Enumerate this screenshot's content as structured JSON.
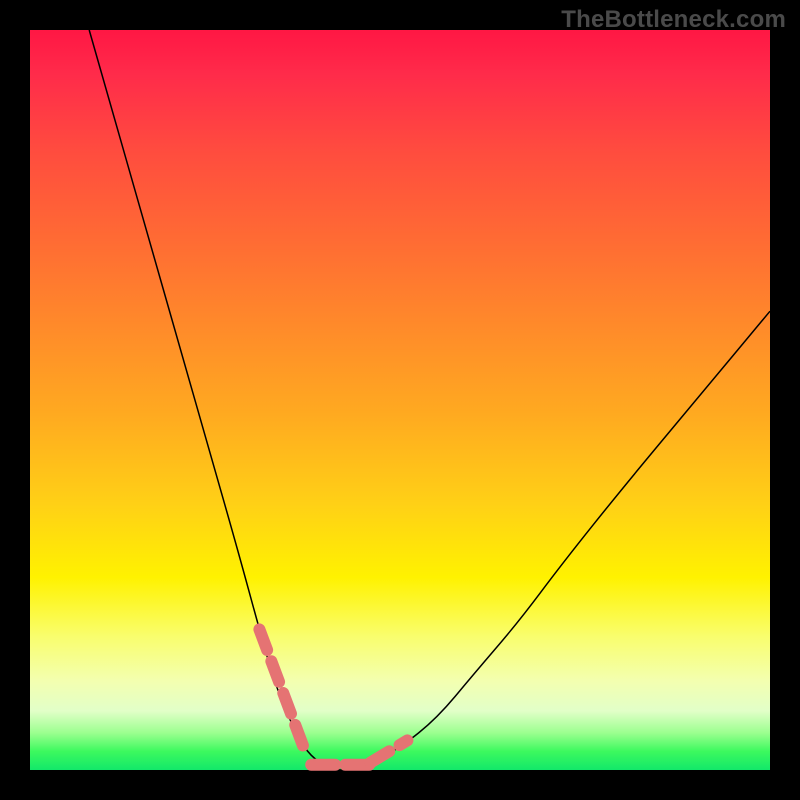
{
  "watermark": "TheBottleneck.com",
  "chart_data": {
    "type": "line",
    "title": "",
    "xlabel": "",
    "ylabel": "",
    "xlim": [
      0,
      100
    ],
    "ylim": [
      0,
      100
    ],
    "grid": false,
    "legend": false,
    "series": [
      {
        "name": "bottleneck-curve",
        "x": [
          8,
          12,
          16,
          20,
          24,
          28,
          31,
          33,
          35,
          37,
          39,
          41,
          43,
          46,
          50,
          55,
          60,
          66,
          72,
          80,
          90,
          100
        ],
        "y": [
          100,
          86,
          72,
          58,
          44,
          30,
          19,
          12,
          7,
          3,
          1,
          0,
          0,
          1,
          3,
          7,
          13,
          20,
          28,
          38,
          50,
          62
        ]
      }
    ],
    "highlight_segments": [
      {
        "name": "left-descent",
        "x": [
          31,
          37
        ],
        "y": [
          19,
          3
        ]
      },
      {
        "name": "valley-floor",
        "x": [
          38,
          46
        ],
        "y": [
          0.7,
          0.7
        ]
      },
      {
        "name": "right-ascent",
        "x": [
          46,
          51
        ],
        "y": [
          1,
          4
        ]
      }
    ],
    "background_gradient": {
      "top": "#ff1744",
      "mid": "#fff200",
      "bottom": "#12e86a"
    }
  }
}
